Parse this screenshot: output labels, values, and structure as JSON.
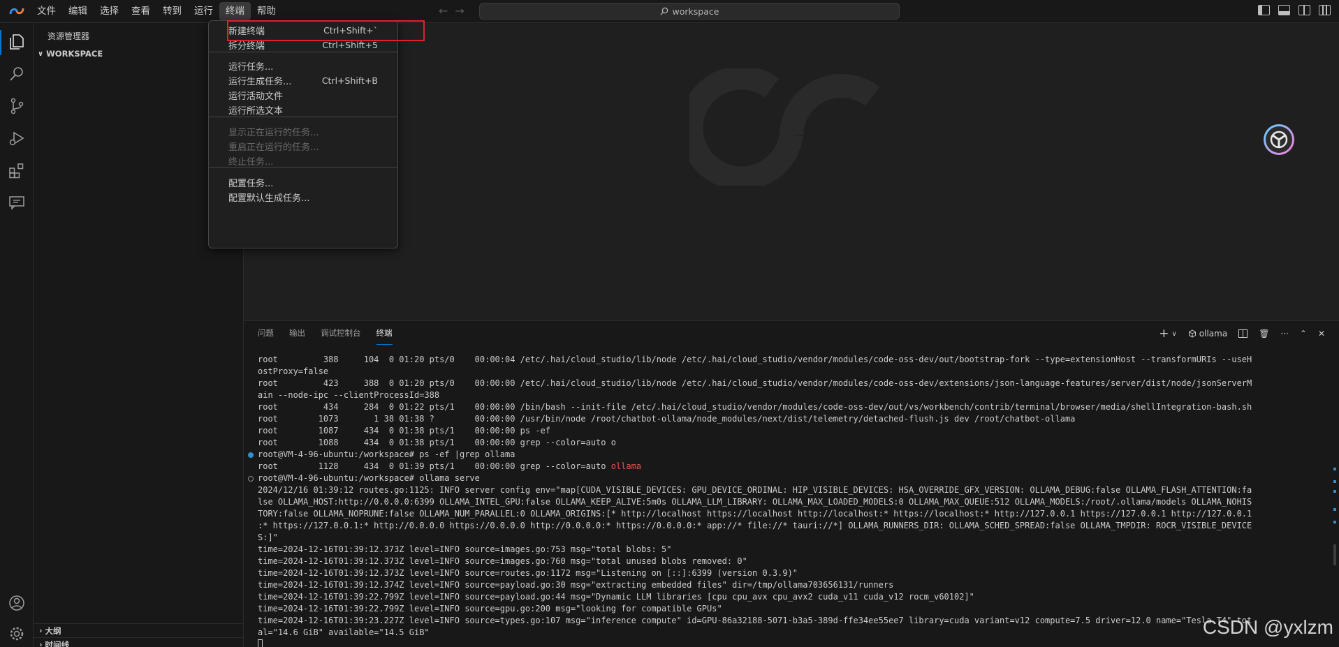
{
  "titlebar": {
    "menu": [
      "文件",
      "编辑",
      "选择",
      "查看",
      "转到",
      "运行",
      "终端",
      "帮助"
    ],
    "active_menu_index": 6,
    "search_text": "workspace"
  },
  "sidebar": {
    "title": "资源管理器",
    "workspace": "WORKSPACE",
    "outline": "大纲",
    "timeline": "时间线"
  },
  "terminal_menu": {
    "items": [
      {
        "label": "新建终端",
        "shortcut": "Ctrl+Shift+`",
        "enabled": true
      },
      {
        "label": "拆分终端",
        "shortcut": "Ctrl+Shift+5",
        "enabled": true
      },
      {
        "label": "运行任务...",
        "shortcut": "",
        "enabled": true
      },
      {
        "label": "运行生成任务...",
        "shortcut": "Ctrl+Shift+B",
        "enabled": true
      },
      {
        "label": "运行活动文件",
        "shortcut": "",
        "enabled": true
      },
      {
        "label": "运行所选文本",
        "shortcut": "",
        "enabled": true
      },
      {
        "label": "显示正在运行的任务...",
        "shortcut": "",
        "enabled": false
      },
      {
        "label": "重启正在运行的任务...",
        "shortcut": "",
        "enabled": false
      },
      {
        "label": "终止任务...",
        "shortcut": "",
        "enabled": false
      },
      {
        "label": "配置任务...",
        "shortcut": "",
        "enabled": true
      },
      {
        "label": "配置默认生成任务...",
        "shortcut": "",
        "enabled": true
      }
    ]
  },
  "panel": {
    "tabs": [
      "问题",
      "输出",
      "调试控制台",
      "终端"
    ],
    "active_tab_index": 3,
    "terminal_name": "ollama"
  },
  "terminal_lines": [
    "root         388     104  0 01:20 pts/0    00:00:04 /etc/.hai/cloud_studio/lib/node /etc/.hai/cloud_studio/vendor/modules/code-oss-dev/out/bootstrap-fork --type=extensionHost --transformURIs --useH",
    "ostProxy=false",
    "root         423     388  0 01:20 pts/0    00:00:00 /etc/.hai/cloud_studio/lib/node /etc/.hai/cloud_studio/vendor/modules/code-oss-dev/extensions/json-language-features/server/dist/node/jsonServerM",
    "ain --node-ipc --clientProcessId=388",
    "root         434     284  0 01:22 pts/1    00:00:00 /bin/bash --init-file /etc/.hai/cloud_studio/vendor/modules/code-oss-dev/out/vs/workbench/contrib/terminal/browser/media/shellIntegration-bash.sh",
    "root        1073       1 38 01:38 ?        00:00:00 /usr/bin/node /root/chatbot-ollama/node_modules/next/dist/telemetry/detached-flush.js dev /root/chatbot-ollama",
    "root        1087     434  0 01:38 pts/1    00:00:00 ps -ef",
    "root        1088     434  0 01:38 pts/1    00:00:00 grep --color=auto o",
    "root@VM-4-96-ubuntu:/workspace# ps -ef |grep ollama",
    "root        1128     434  0 01:39 pts/1    00:00:00 grep --color=auto ",
    "root@VM-4-96-ubuntu:/workspace# ollama serve",
    "2024/12/16 01:39:12 routes.go:1125: INFO server config env=\"map[CUDA_VISIBLE_DEVICES: GPU_DEVICE_ORDINAL: HIP_VISIBLE_DEVICES: HSA_OVERRIDE_GFX_VERSION: OLLAMA_DEBUG:false OLLAMA_FLASH_ATTENTION:fa",
    "lse OLLAMA_HOST:http://0.0.0.0:6399 OLLAMA_INTEL_GPU:false OLLAMA_KEEP_ALIVE:5m0s OLLAMA_LLM_LIBRARY: OLLAMA_MAX_LOADED_MODELS:0 OLLAMA_MAX_QUEUE:512 OLLAMA_MODELS:/root/.ollama/models OLLAMA_NOHIS",
    "TORY:false OLLAMA_NOPRUNE:false OLLAMA_NUM_PARALLEL:0 OLLAMA_ORIGINS:[* http://localhost https://localhost http://localhost:* https://localhost:* http://127.0.0.1 https://127.0.0.1 http://127.0.0.1",
    ":* https://127.0.0.1:* http://0.0.0.0 https://0.0.0.0 http://0.0.0.0:* https://0.0.0.0:* app://* file://* tauri://*] OLLAMA_RUNNERS_DIR: OLLAMA_SCHED_SPREAD:false OLLAMA_TMPDIR: ROCR_VISIBLE_DEVICE",
    "S:]\"",
    "time=2024-12-16T01:39:12.373Z level=INFO source=images.go:753 msg=\"total blobs: 5\"",
    "time=2024-12-16T01:39:12.373Z level=INFO source=images.go:760 msg=\"total unused blobs removed: 0\"",
    "time=2024-12-16T01:39:12.373Z level=INFO source=routes.go:1172 msg=\"Listening on [::]:6399 (version 0.3.9)\"",
    "time=2024-12-16T01:39:12.374Z level=INFO source=payload.go:30 msg=\"extracting embedded files\" dir=/tmp/ollama703656131/runners",
    "time=2024-12-16T01:39:22.799Z level=INFO source=payload.go:44 msg=\"Dynamic LLM libraries [cpu cpu_avx cpu_avx2 cuda_v11 cuda_v12 rocm_v60102]\"",
    "time=2024-12-16T01:39:22.799Z level=INFO source=gpu.go:200 msg=\"looking for compatible GPUs\"",
    "time=2024-12-16T01:39:23.227Z level=INFO source=types.go:107 msg=\"inference compute\" id=GPU-86a32188-5071-b3a5-389d-ffe34ee55ee7 library=cuda variant=v12 compute=7.5 driver=12.0 name=\"Tesla T4\" tot",
    "al=\"14.6 GiB\" available=\"14.5 GiB\""
  ],
  "terminal_highlight": "ollama",
  "watermark_text": "CSDN @yxlzm"
}
